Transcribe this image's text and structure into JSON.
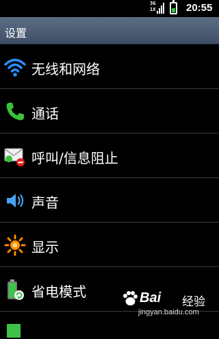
{
  "status_bar": {
    "network_type": "3G",
    "network_subtype": "1X",
    "time": "20:55",
    "battery_level": 0.5
  },
  "title_bar": {
    "title": "设置"
  },
  "menu": {
    "items": [
      {
        "label": "无线和网络",
        "icon": "wifi-icon"
      },
      {
        "label": "通话",
        "icon": "phone-icon"
      },
      {
        "label": "呼叫/信息阻止",
        "icon": "block-message-icon"
      },
      {
        "label": "声音",
        "icon": "speaker-icon"
      },
      {
        "label": "显示",
        "icon": "brightness-icon"
      },
      {
        "label": "省电模式",
        "icon": "power-saving-icon"
      }
    ]
  },
  "watermark": {
    "brand": "Bai",
    "brand_suffix": "经验",
    "url": "jingyan.baidu.com"
  },
  "colors": {
    "background": "#000000",
    "title_bar": "#4a5a72",
    "wifi_icon": "#2a8cff",
    "phone_icon": "#3ac23a",
    "speaker_icon": "#4aa0f0",
    "brightness_icon": "#ff8c00"
  }
}
